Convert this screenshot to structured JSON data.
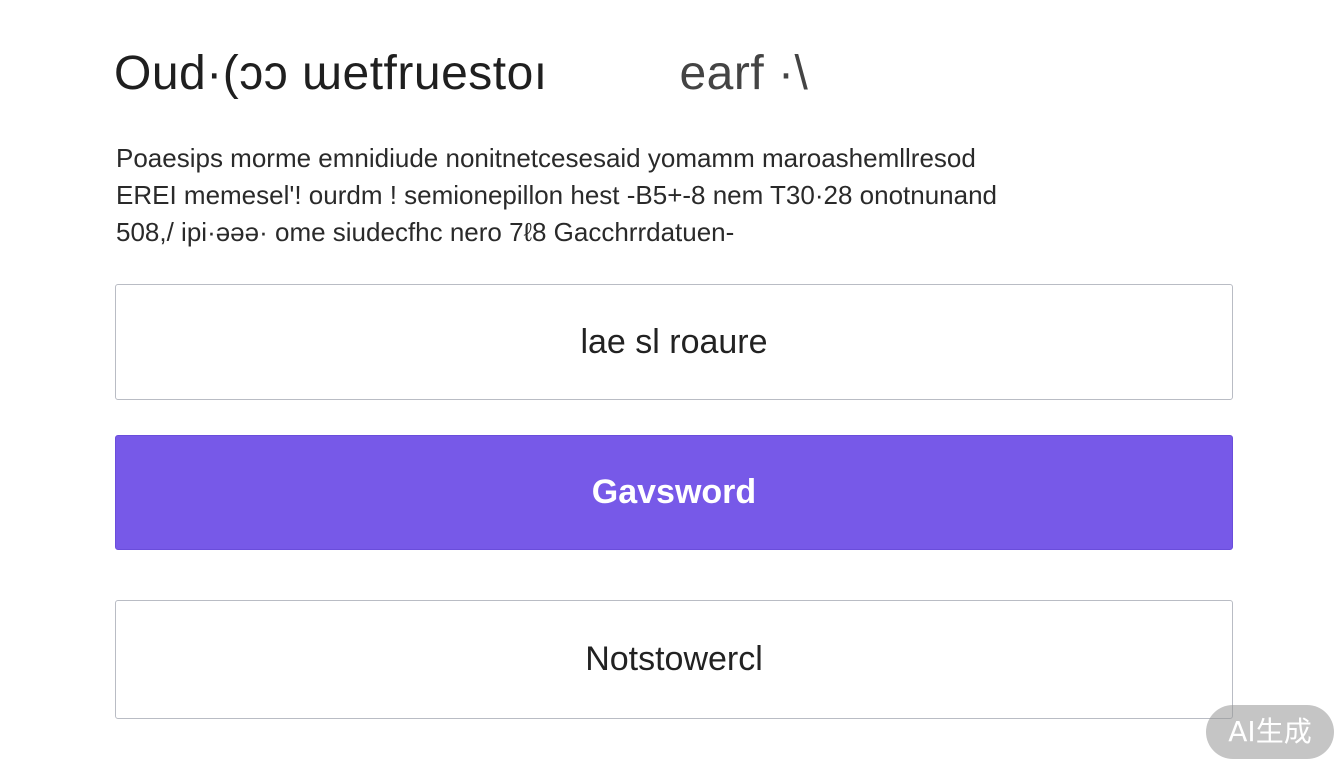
{
  "header": {
    "title_main": "Oud·(ɔɔ ɯetfruestoı",
    "title_tail": "earf ·\\"
  },
  "description": {
    "lines": [
      "Poaesips morme emnidiude nonitnetcesesaid yomamm maroashemllresod",
      "EREI memesel'! ourdm ! semionepillon hest -B5+-8 nem T30·28 onotnunand",
      "508,/ ipi·ǝǝǝ· ome siudecfhc nero 7ℓ8 Gacchrrdatuen-"
    ]
  },
  "buttons": {
    "top_label": "lae sl roaure",
    "primary_label": "Gavsword",
    "bottom_label": "Notstowercl"
  },
  "watermark": {
    "label": "AI生成"
  },
  "colors": {
    "primary": "#7759e8",
    "outline_border": "#b9bcc4",
    "background": "#ffffff"
  }
}
